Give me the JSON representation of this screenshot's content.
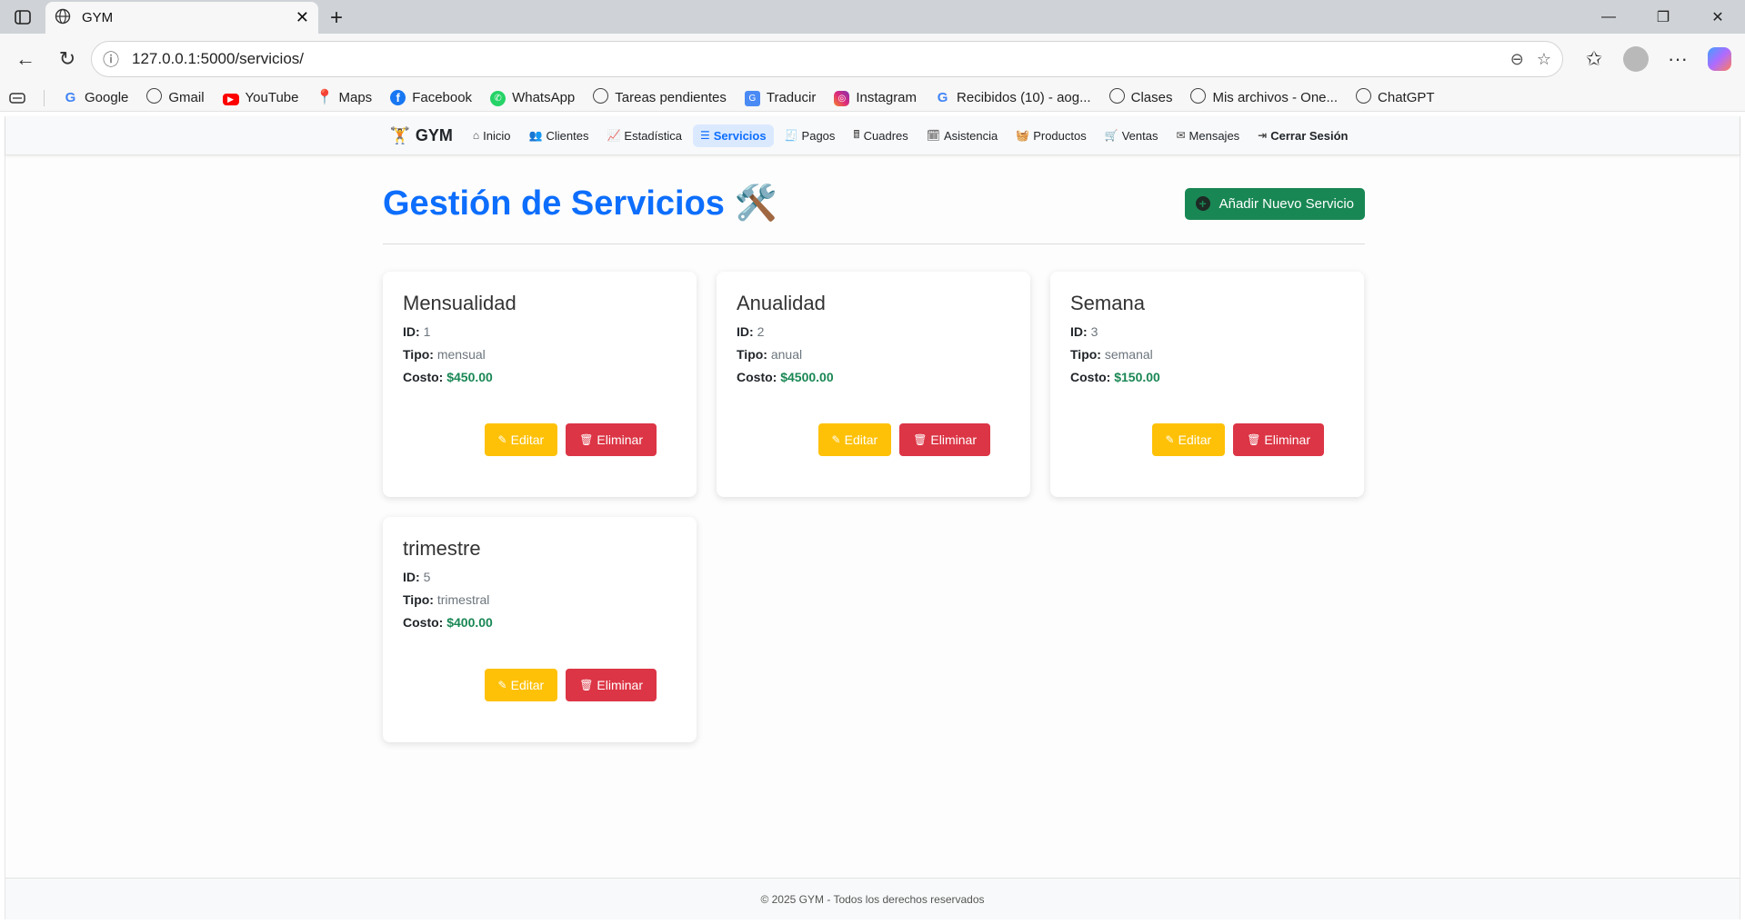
{
  "browser": {
    "tab_title": "GYM",
    "url": "127.0.0.1:5000/servicios/",
    "bookmarks": [
      {
        "label": "Google",
        "icon": "google-icon"
      },
      {
        "label": "Gmail",
        "icon": "globe-icon"
      },
      {
        "label": "YouTube",
        "icon": "youtube-icon"
      },
      {
        "label": "Maps",
        "icon": "maps-icon"
      },
      {
        "label": "Facebook",
        "icon": "facebook-icon"
      },
      {
        "label": "WhatsApp",
        "icon": "whatsapp-icon"
      },
      {
        "label": "Tareas pendientes",
        "icon": "globe-icon"
      },
      {
        "label": "Traducir",
        "icon": "translate-icon"
      },
      {
        "label": "Instagram",
        "icon": "instagram-icon"
      },
      {
        "label": "Recibidos (10) - aog...",
        "icon": "google-icon"
      },
      {
        "label": "Clases",
        "icon": "globe-icon"
      },
      {
        "label": "Mis archivos - One...",
        "icon": "globe-icon"
      },
      {
        "label": "ChatGPT",
        "icon": "globe-icon"
      }
    ]
  },
  "nav": {
    "brand": "GYM",
    "items": [
      {
        "label": "Inicio",
        "icon": "home-icon"
      },
      {
        "label": "Clientes",
        "icon": "users-icon"
      },
      {
        "label": "Estadística",
        "icon": "chart-icon"
      },
      {
        "label": "Servicios",
        "icon": "list-icon",
        "active": true
      },
      {
        "label": "Pagos",
        "icon": "payment-icon"
      },
      {
        "label": "Cuadres",
        "icon": "cash-register-icon"
      },
      {
        "label": "Asistencia",
        "icon": "calendar-check-icon"
      },
      {
        "label": "Productos",
        "icon": "basket-icon"
      },
      {
        "label": "Ventas",
        "icon": "cart-icon"
      },
      {
        "label": "Mensajes",
        "icon": "envelope-icon"
      },
      {
        "label": "Cerrar Sesión",
        "icon": "logout-icon"
      }
    ]
  },
  "page": {
    "title": "Gestión de Servicios",
    "title_emoji": "🛠️",
    "add_button": "Añadir Nuevo Servicio"
  },
  "labels": {
    "id": "ID:",
    "tipo": "Tipo:",
    "costo": "Costo:",
    "edit": "Editar",
    "delete": "Eliminar"
  },
  "services": [
    {
      "name": "Mensualidad",
      "id": "1",
      "tipo": "mensual",
      "costo": "$450.00"
    },
    {
      "name": "Anualidad",
      "id": "2",
      "tipo": "anual",
      "costo": "$4500.00"
    },
    {
      "name": "Semana",
      "id": "3",
      "tipo": "semanal",
      "costo": "$150.00"
    },
    {
      "name": "trimestre",
      "id": "5",
      "tipo": "trimestral",
      "costo": "$400.00"
    }
  ],
  "footer": "© 2025 GYM - Todos los derechos reservados",
  "colors": {
    "primary": "#0d6efd",
    "success": "#198754",
    "warning": "#ffc107",
    "danger": "#dc3545"
  }
}
